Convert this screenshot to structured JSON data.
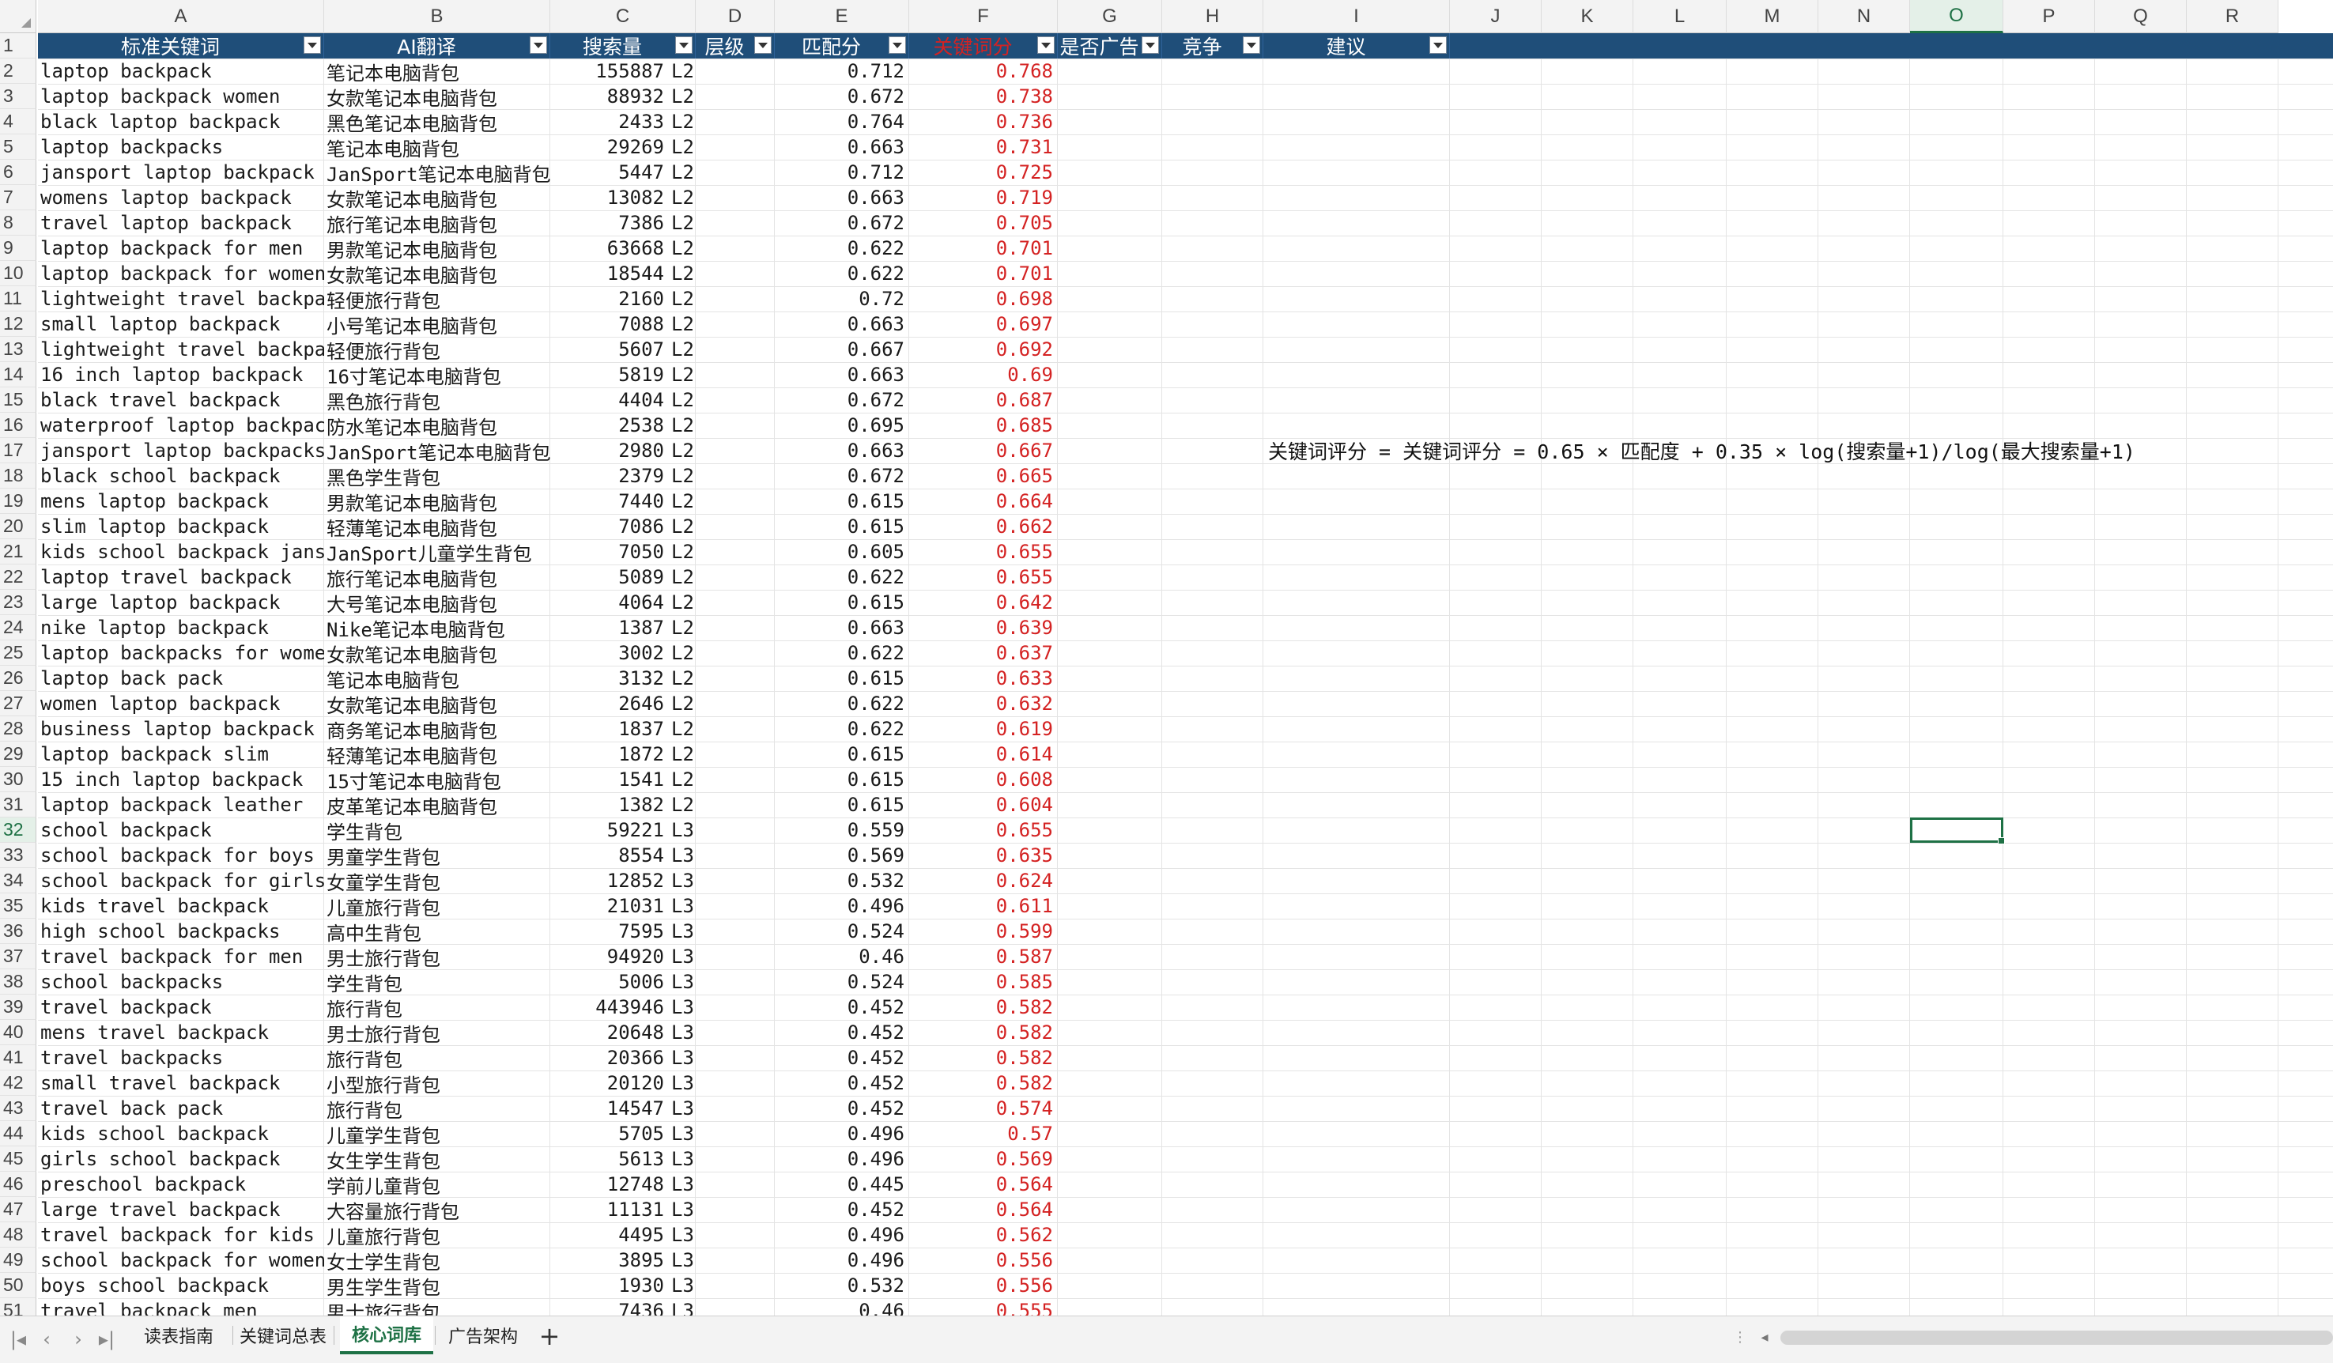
{
  "column_letters": [
    "A",
    "B",
    "C",
    "D",
    "E",
    "F",
    "G",
    "H",
    "I",
    "J",
    "K",
    "L",
    "M",
    "N",
    "O",
    "P",
    "Q",
    "R"
  ],
  "active_column": "O",
  "header_row": {
    "row_number": "1",
    "cells": [
      "标准关键词",
      "AI翻译",
      "搜索量",
      "层级",
      "匹配分",
      "关键词分",
      "是否广告",
      "竞争",
      "建议"
    ]
  },
  "rows": [
    {
      "n": "2",
      "keyword": "laptop backpack",
      "translation": "笔记本电脑背包",
      "volume": "155887",
      "level": "L2",
      "match": "0.712",
      "score": "0.768"
    },
    {
      "n": "3",
      "keyword": "laptop backpack women",
      "translation": "女款笔记本电脑背包",
      "volume": "88932",
      "level": "L2",
      "match": "0.672",
      "score": "0.738"
    },
    {
      "n": "4",
      "keyword": "black laptop backpack",
      "translation": "黑色笔记本电脑背包",
      "volume": "2433",
      "level": "L2",
      "match": "0.764",
      "score": "0.736"
    },
    {
      "n": "5",
      "keyword": "laptop backpacks",
      "translation": "笔记本电脑背包",
      "volume": "29269",
      "level": "L2",
      "match": "0.663",
      "score": "0.731"
    },
    {
      "n": "6",
      "keyword": "jansport laptop backpack",
      "translation": "JanSport笔记本电脑背包",
      "volume": "5447",
      "level": "L2",
      "match": "0.712",
      "score": "0.725"
    },
    {
      "n": "7",
      "keyword": "womens laptop backpack",
      "translation": "女款笔记本电脑背包",
      "volume": "13082",
      "level": "L2",
      "match": "0.663",
      "score": "0.719"
    },
    {
      "n": "8",
      "keyword": "travel laptop backpack",
      "translation": "旅行笔记本电脑背包",
      "volume": "7386",
      "level": "L2",
      "match": "0.672",
      "score": "0.705"
    },
    {
      "n": "9",
      "keyword": "laptop backpack for men",
      "translation": "男款笔记本电脑背包",
      "volume": "63668",
      "level": "L2",
      "match": "0.622",
      "score": "0.701"
    },
    {
      "n": "10",
      "keyword": "laptop backpack for women",
      "translation": "女款笔记本电脑背包",
      "volume": "18544",
      "level": "L2",
      "match": "0.622",
      "score": "0.701"
    },
    {
      "n": "11",
      "keyword": "lightweight travel backpack",
      "translation": "轻便旅行背包",
      "volume": "2160",
      "level": "L2",
      "match": "0.72",
      "score": "0.698"
    },
    {
      "n": "12",
      "keyword": "small laptop backpack",
      "translation": "小号笔记本电脑背包",
      "volume": "7088",
      "level": "L2",
      "match": "0.663",
      "score": "0.697"
    },
    {
      "n": "13",
      "keyword": "lightweight travel backpacks",
      "translation": "轻便旅行背包",
      "volume": "5607",
      "level": "L2",
      "match": "0.667",
      "score": "0.692"
    },
    {
      "n": "14",
      "keyword": "16 inch laptop backpack",
      "translation": "16寸笔记本电脑背包",
      "volume": "5819",
      "level": "L2",
      "match": "0.663",
      "score": "0.69"
    },
    {
      "n": "15",
      "keyword": "black travel backpack",
      "translation": "黑色旅行背包",
      "volume": "4404",
      "level": "L2",
      "match": "0.672",
      "score": "0.687"
    },
    {
      "n": "16",
      "keyword": "waterproof laptop backpack",
      "translation": "防水笔记本电脑背包",
      "volume": "2538",
      "level": "L2",
      "match": "0.695",
      "score": "0.685"
    },
    {
      "n": "17",
      "keyword": "jansport laptop backpacks",
      "translation": "JanSport笔记本电脑背包",
      "volume": "2980",
      "level": "L2",
      "match": "0.663",
      "score": "0.667"
    },
    {
      "n": "18",
      "keyword": "black school backpack",
      "translation": "黑色学生背包",
      "volume": "2379",
      "level": "L2",
      "match": "0.672",
      "score": "0.665"
    },
    {
      "n": "19",
      "keyword": "mens laptop backpack",
      "translation": "男款笔记本电脑背包",
      "volume": "7440",
      "level": "L2",
      "match": "0.615",
      "score": "0.664"
    },
    {
      "n": "20",
      "keyword": "slim laptop backpack",
      "translation": "轻薄笔记本电脑背包",
      "volume": "7086",
      "level": "L2",
      "match": "0.615",
      "score": "0.662"
    },
    {
      "n": "21",
      "keyword": "kids school backpack jansport",
      "translation": "JanSport儿童学生背包",
      "volume": "7050",
      "level": "L2",
      "match": "0.605",
      "score": "0.655"
    },
    {
      "n": "22",
      "keyword": "laptop travel backpack",
      "translation": "旅行笔记本电脑背包",
      "volume": "5089",
      "level": "L2",
      "match": "0.622",
      "score": "0.655"
    },
    {
      "n": "23",
      "keyword": "large laptop backpack",
      "translation": "大号笔记本电脑背包",
      "volume": "4064",
      "level": "L2",
      "match": "0.615",
      "score": "0.642"
    },
    {
      "n": "24",
      "keyword": "nike laptop backpack",
      "translation": "Nike笔记本电脑背包",
      "volume": "1387",
      "level": "L2",
      "match": "0.663",
      "score": "0.639"
    },
    {
      "n": "25",
      "keyword": "laptop backpacks for women",
      "translation": "女款笔记本电脑背包",
      "volume": "3002",
      "level": "L2",
      "match": "0.622",
      "score": "0.637"
    },
    {
      "n": "26",
      "keyword": "laptop back pack",
      "translation": "笔记本电脑背包",
      "volume": "3132",
      "level": "L2",
      "match": "0.615",
      "score": "0.633"
    },
    {
      "n": "27",
      "keyword": "women laptop backpack",
      "translation": "女款笔记本电脑背包",
      "volume": "2646",
      "level": "L2",
      "match": "0.622",
      "score": "0.632"
    },
    {
      "n": "28",
      "keyword": "business laptop backpack",
      "translation": "商务笔记本电脑背包",
      "volume": "1837",
      "level": "L2",
      "match": "0.622",
      "score": "0.619"
    },
    {
      "n": "29",
      "keyword": "laptop backpack slim",
      "translation": "轻薄笔记本电脑背包",
      "volume": "1872",
      "level": "L2",
      "match": "0.615",
      "score": "0.614"
    },
    {
      "n": "30",
      "keyword": "15 inch laptop backpack",
      "translation": "15寸笔记本电脑背包",
      "volume": "1541",
      "level": "L2",
      "match": "0.615",
      "score": "0.608"
    },
    {
      "n": "31",
      "keyword": "laptop backpack leather",
      "translation": "皮革笔记本电脑背包",
      "volume": "1382",
      "level": "L2",
      "match": "0.615",
      "score": "0.604"
    },
    {
      "n": "32",
      "keyword": "school backpack",
      "translation": "学生背包",
      "volume": "59221",
      "level": "L3",
      "match": "0.559",
      "score": "0.655"
    },
    {
      "n": "33",
      "keyword": "school backpack for boys",
      "translation": "男童学生背包",
      "volume": "8554",
      "level": "L3",
      "match": "0.569",
      "score": "0.635"
    },
    {
      "n": "34",
      "keyword": "school backpack for girls",
      "translation": "女童学生背包",
      "volume": "12852",
      "level": "L3",
      "match": "0.532",
      "score": "0.624"
    },
    {
      "n": "35",
      "keyword": "kids travel backpack",
      "translation": "儿童旅行背包",
      "volume": "21031",
      "level": "L3",
      "match": "0.496",
      "score": "0.611"
    },
    {
      "n": "36",
      "keyword": "high school backpacks",
      "translation": "高中生背包",
      "volume": "7595",
      "level": "L3",
      "match": "0.524",
      "score": "0.599"
    },
    {
      "n": "37",
      "keyword": "travel backpack for men",
      "translation": "男士旅行背包",
      "volume": "94920",
      "level": "L3",
      "match": "0.46",
      "score": "0.587"
    },
    {
      "n": "38",
      "keyword": "school backpacks",
      "translation": "学生背包",
      "volume": "5006",
      "level": "L3",
      "match": "0.524",
      "score": "0.585"
    },
    {
      "n": "39",
      "keyword": "travel backpack",
      "translation": "旅行背包",
      "volume": "443946",
      "level": "L3",
      "match": "0.452",
      "score": "0.582"
    },
    {
      "n": "40",
      "keyword": "mens travel backpack",
      "translation": "男士旅行背包",
      "volume": "20648",
      "level": "L3",
      "match": "0.452",
      "score": "0.582"
    },
    {
      "n": "41",
      "keyword": "travel backpacks",
      "translation": "旅行背包",
      "volume": "20366",
      "level": "L3",
      "match": "0.452",
      "score": "0.582"
    },
    {
      "n": "42",
      "keyword": "small travel backpack",
      "translation": "小型旅行背包",
      "volume": "20120",
      "level": "L3",
      "match": "0.452",
      "score": "0.582"
    },
    {
      "n": "43",
      "keyword": "travel back pack",
      "translation": "旅行背包",
      "volume": "14547",
      "level": "L3",
      "match": "0.452",
      "score": "0.574"
    },
    {
      "n": "44",
      "keyword": "kids school backpack",
      "translation": "儿童学生背包",
      "volume": "5705",
      "level": "L3",
      "match": "0.496",
      "score": "0.57"
    },
    {
      "n": "45",
      "keyword": "girls school backpack",
      "translation": "女生学生背包",
      "volume": "5613",
      "level": "L3",
      "match": "0.496",
      "score": "0.569"
    },
    {
      "n": "46",
      "keyword": "preschool backpack",
      "translation": "学前儿童背包",
      "volume": "12748",
      "level": "L3",
      "match": "0.445",
      "score": "0.564"
    },
    {
      "n": "47",
      "keyword": "large travel backpack",
      "translation": "大容量旅行背包",
      "volume": "11131",
      "level": "L3",
      "match": "0.452",
      "score": "0.564"
    },
    {
      "n": "48",
      "keyword": "travel backpack for kids",
      "translation": "儿童旅行背包",
      "volume": "4495",
      "level": "L3",
      "match": "0.496",
      "score": "0.562"
    },
    {
      "n": "49",
      "keyword": "school backpack for women",
      "translation": "女士学生背包",
      "volume": "3895",
      "level": "L3",
      "match": "0.496",
      "score": "0.556"
    },
    {
      "n": "50",
      "keyword": "boys school backpack",
      "translation": "男生学生背包",
      "volume": "1930",
      "level": "L3",
      "match": "0.532",
      "score": "0.556"
    },
    {
      "n": "51",
      "keyword": "travel backpack men",
      "translation": "男士旅行背包",
      "volume": "7436",
      "level": "L3",
      "match": "0.46",
      "score": "0.555"
    }
  ],
  "active_row": "32",
  "formula_note": "关键词评分 = 关键词评分 = 0.65 × 匹配度 + 0.35 × log(搜索量+1)/log(最大搜索量+1)",
  "sheet_tabs": [
    "读表指南",
    "关键词总表",
    "核心词库",
    "广告架构"
  ],
  "active_tab": "核心词库",
  "colors": {
    "header_bg": "#1f4e79",
    "score_red": "#d42222",
    "accent_green": "#1e7145"
  }
}
